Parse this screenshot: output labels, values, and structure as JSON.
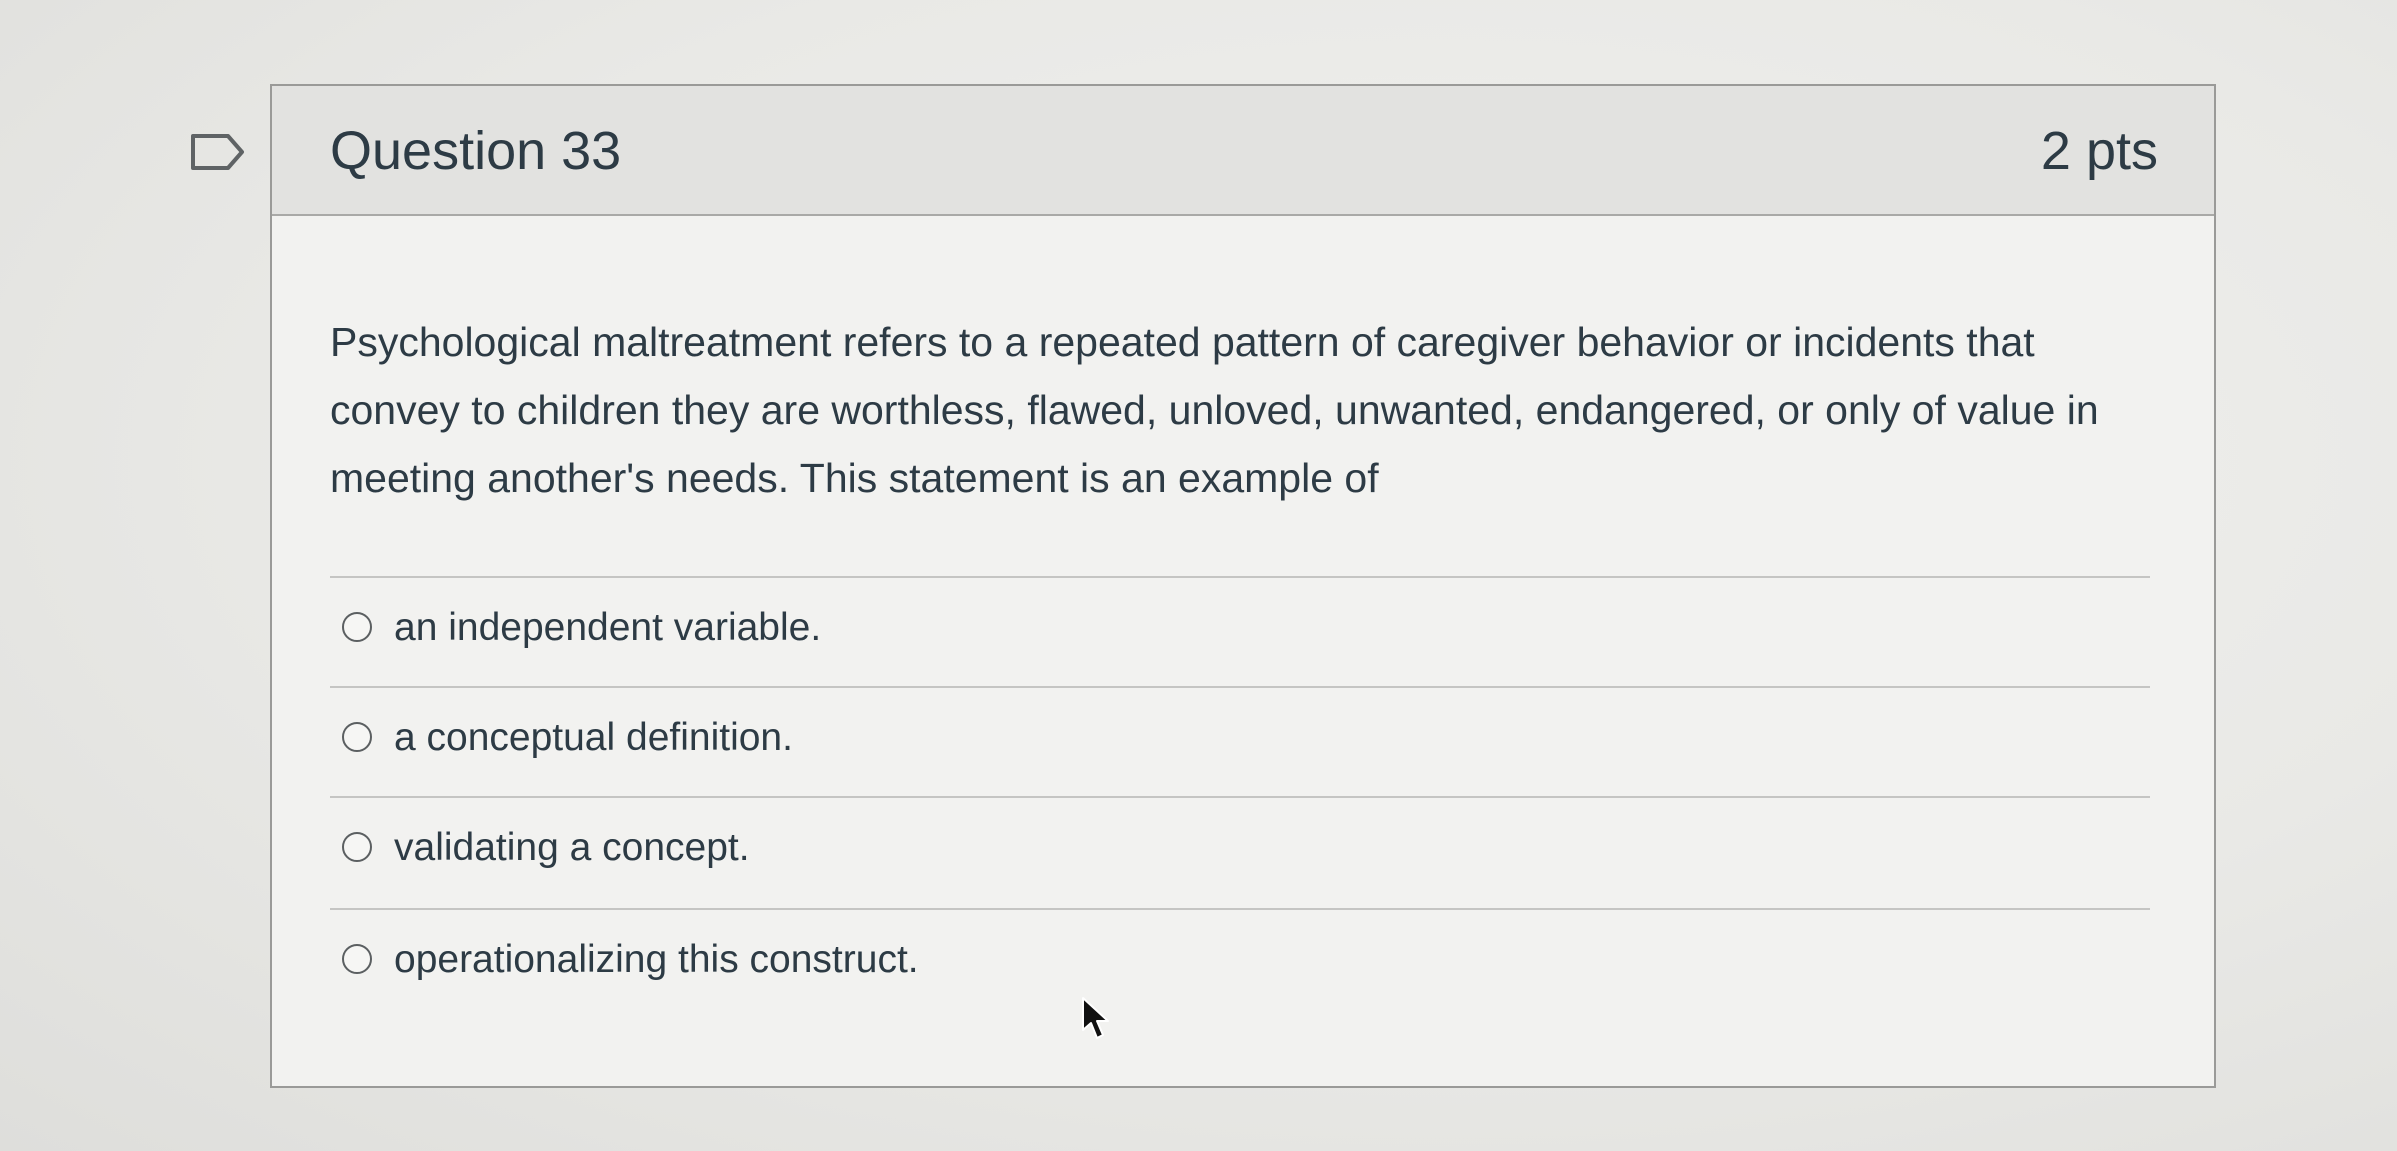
{
  "question": {
    "title": "Question 33",
    "points": "2 pts",
    "text": "Psychological maltreatment refers to a repeated pattern of caregiver behavior or incidents that convey to children they are worthless, flawed, unloved, unwanted, endangered, or only of value in meeting another's needs. This statement is an example of",
    "answers": [
      {
        "label": "an independent variable.",
        "selected": false
      },
      {
        "label": "a conceptual definition.",
        "selected": false
      },
      {
        "label": "validating a concept.",
        "selected": false
      },
      {
        "label": "operationalizing this construct.",
        "selected": false
      }
    ]
  },
  "icons": {
    "flag": "flag-question-icon",
    "radio": "radio-button-icon",
    "cursor": "mouse-cursor-icon"
  },
  "colors": {
    "text": "#2d3b45",
    "header_background": "#e2e2e0",
    "card_background": "#f2f2f0",
    "border": "#9a9a98"
  }
}
